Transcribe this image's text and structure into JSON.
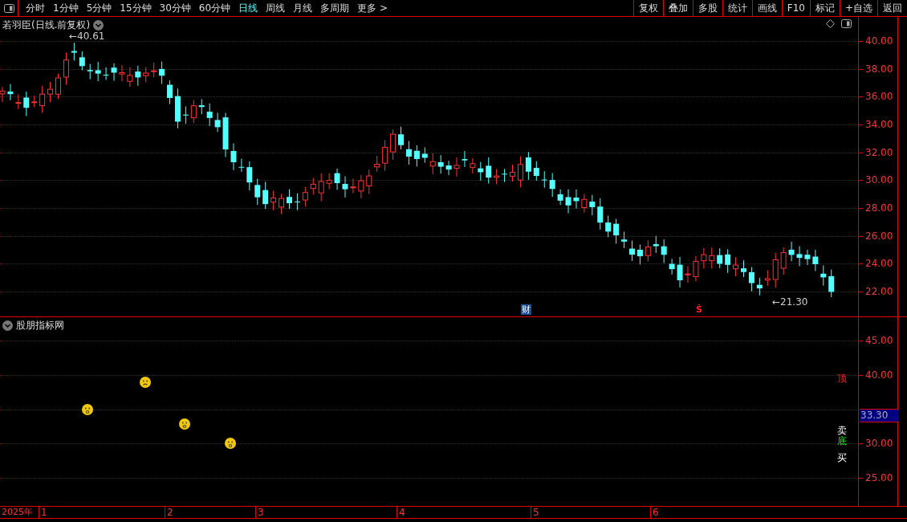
{
  "toolbar": {
    "periods": [
      {
        "label": "分时",
        "selected": false
      },
      {
        "label": "1分钟",
        "selected": false
      },
      {
        "label": "5分钟",
        "selected": false
      },
      {
        "label": "15分钟",
        "selected": false
      },
      {
        "label": "30分钟",
        "selected": false
      },
      {
        "label": "60分钟",
        "selected": false
      },
      {
        "label": "日线",
        "selected": true
      },
      {
        "label": "周线",
        "selected": false
      },
      {
        "label": "月线",
        "selected": false
      },
      {
        "label": "多周期",
        "selected": false
      },
      {
        "label": "更多 >",
        "selected": false
      }
    ],
    "actions": [
      "复权",
      "叠加",
      "多股",
      "统计",
      "画线",
      "F10",
      "标记",
      "+自选",
      "返回"
    ]
  },
  "price_chart": {
    "title": "若羽臣(日线.前复权)",
    "high_label": "←40.61",
    "low_label": "←21.30",
    "events": [
      {
        "label": "财",
        "kind": "finance"
      },
      {
        "label": "Ŝ",
        "kind": "dividend"
      }
    ],
    "y_ticks": [
      "40.00",
      "38.00",
      "36.00",
      "34.00",
      "32.00",
      "30.00",
      "28.00",
      "26.00",
      "24.00",
      "22.00"
    ]
  },
  "indicator": {
    "title": "股朋指标网",
    "y_ticks": [
      "45.00",
      "40.00",
      "30.00",
      "25.00"
    ],
    "price_tag": "33.30",
    "signals": [
      {
        "label": "顶",
        "kind": "top"
      },
      {
        "label": "卖",
        "kind": "sell"
      },
      {
        "label": "底",
        "kind": "bottom"
      },
      {
        "label": "买",
        "kind": "buy"
      }
    ],
    "markers": [
      {
        "kind": "surprised"
      },
      {
        "kind": "sad"
      },
      {
        "kind": "surprised"
      },
      {
        "kind": "surprised"
      }
    ]
  },
  "date_axis": {
    "year": "2025年",
    "months": [
      "1",
      "2",
      "3",
      "4",
      "5",
      "6"
    ]
  }
}
